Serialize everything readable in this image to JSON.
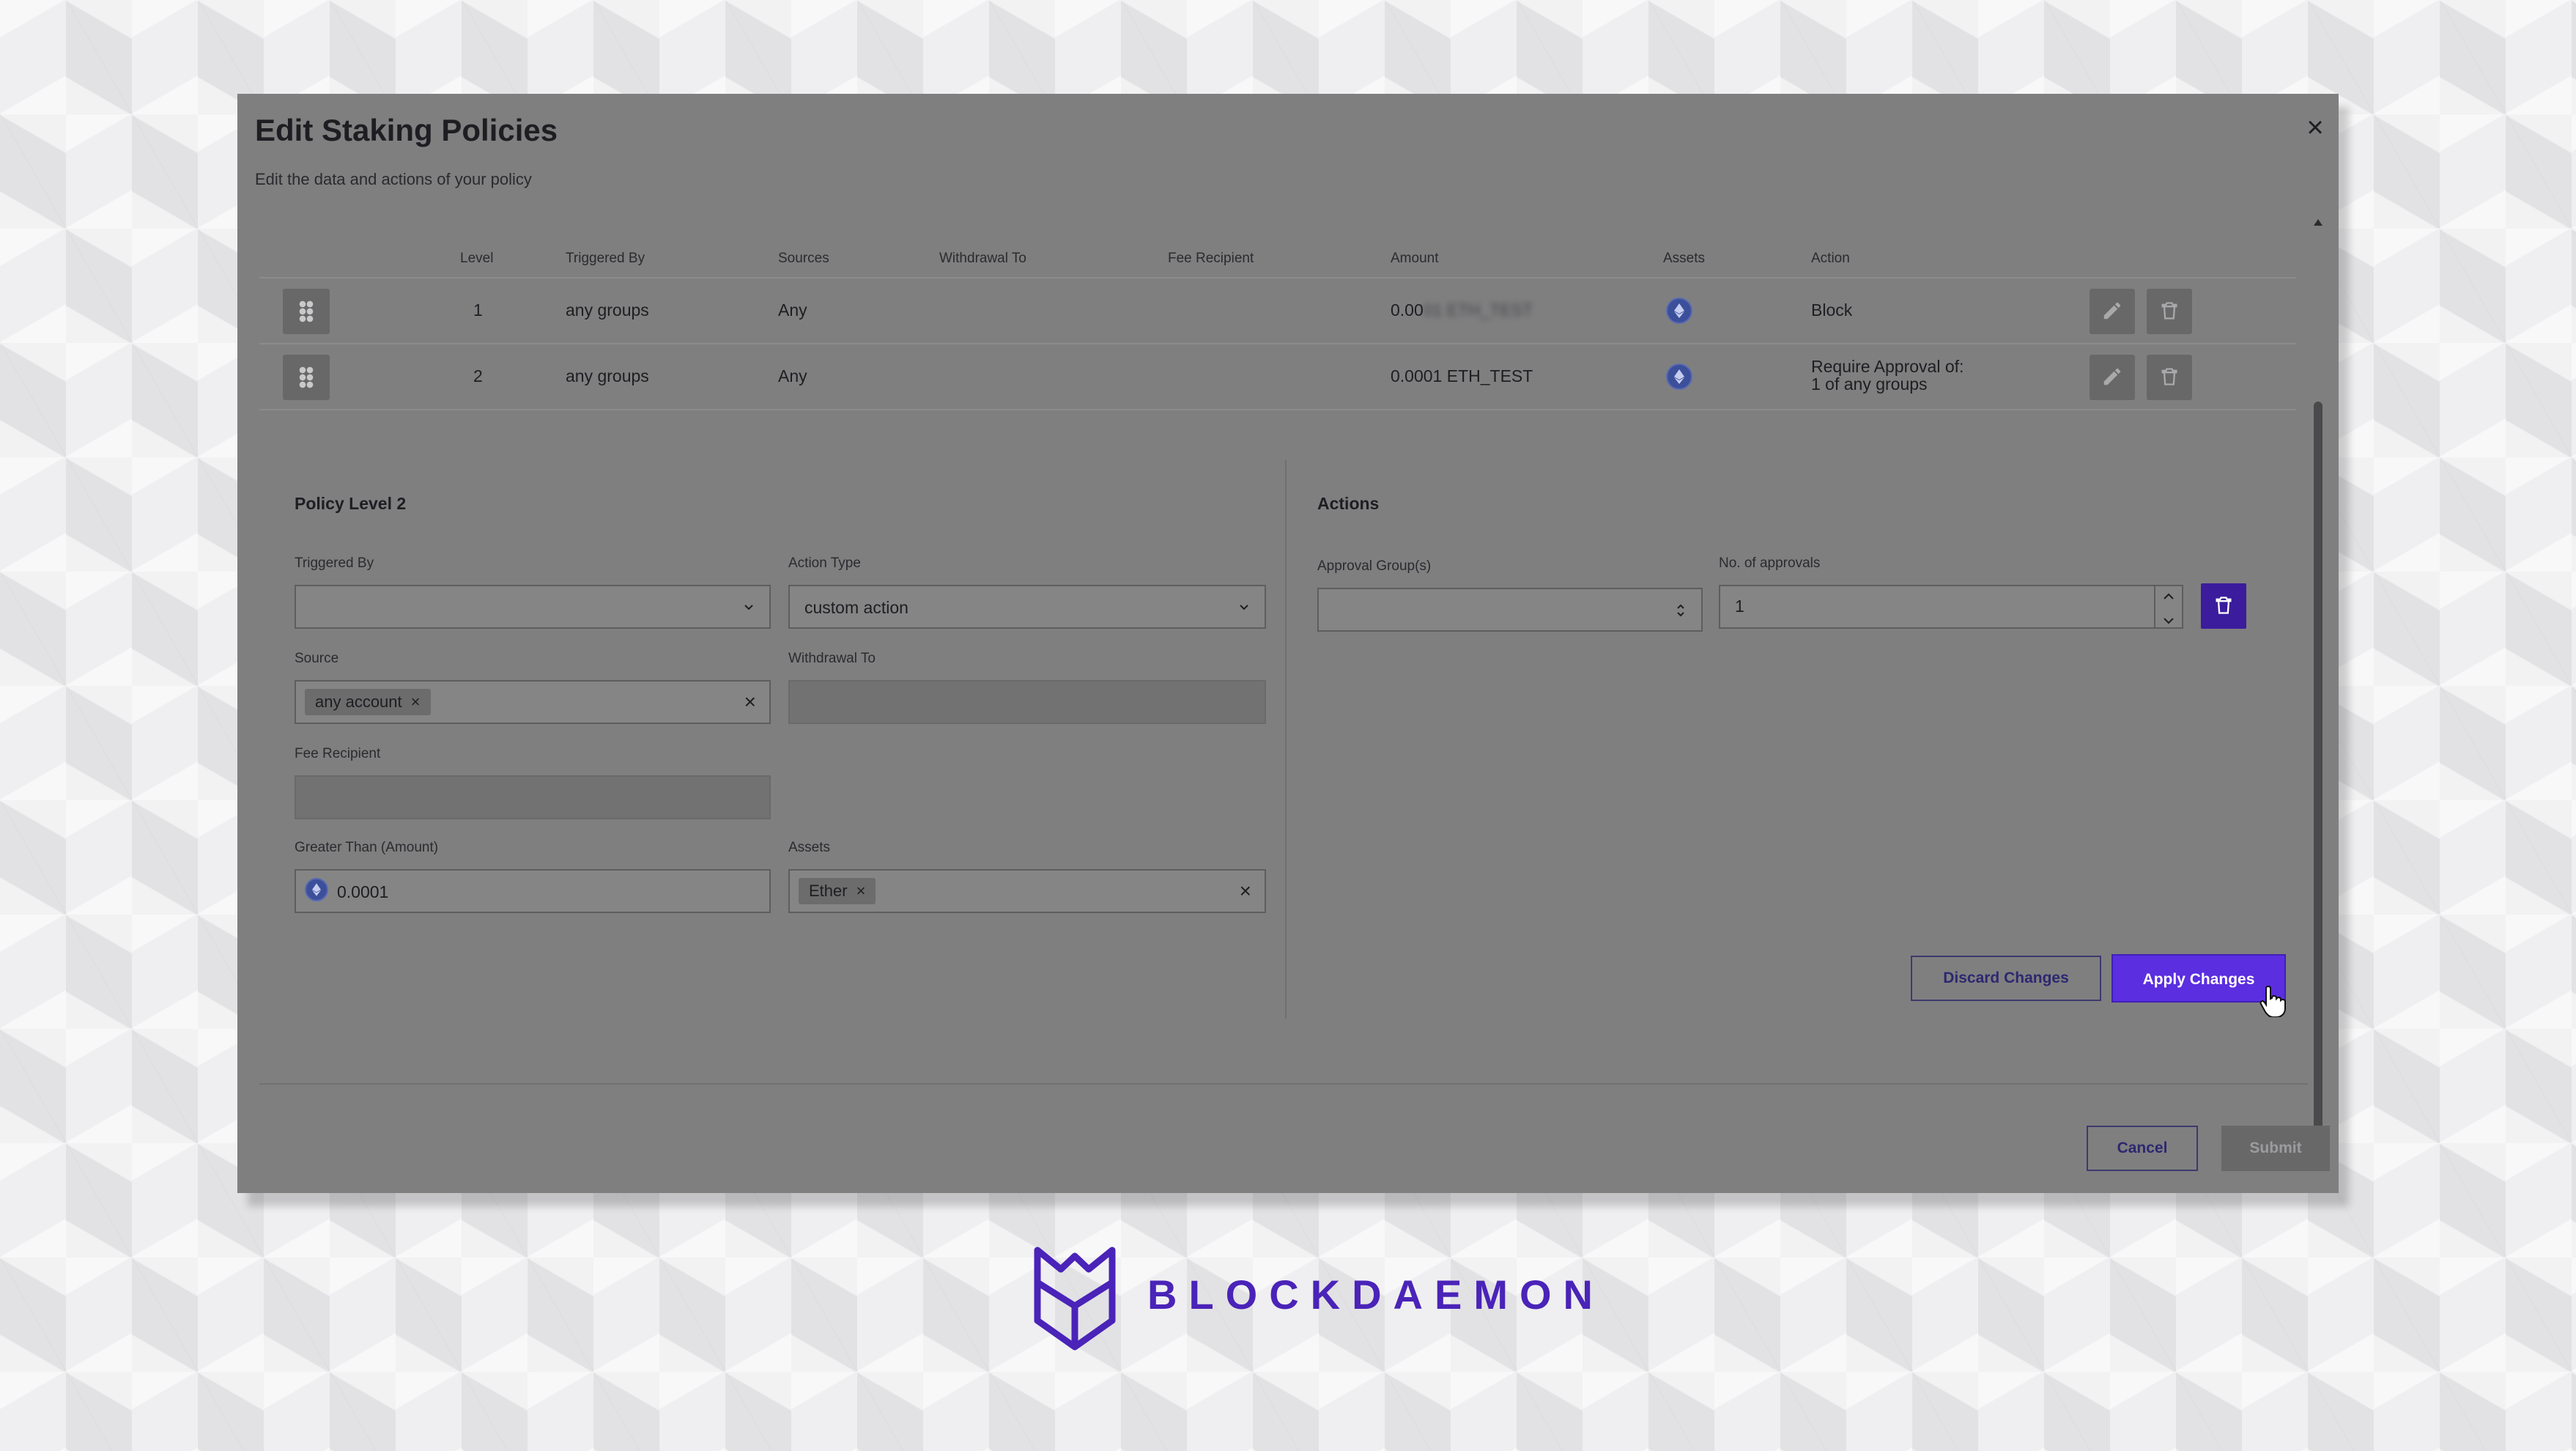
{
  "modal": {
    "title": "Edit Staking Policies",
    "subtitle": "Edit the data and actions of your policy"
  },
  "table": {
    "headers": [
      "Level",
      "Triggered By",
      "Sources",
      "Withdrawal To",
      "Fee Recipient",
      "Amount",
      "Assets",
      "Action"
    ],
    "rows": [
      {
        "level": "1",
        "triggered_by": "any groups",
        "sources": "Any",
        "amount": "0.00",
        "amount_blurred": "01 ETH_TEST",
        "action_line1": "Block",
        "action_line2": ""
      },
      {
        "level": "2",
        "triggered_by": "any groups",
        "sources": "Any",
        "amount": "0.0001 ETH_TEST",
        "amount_blurred": "",
        "action_line1": "Require Approval of:",
        "action_line2": "1 of any groups"
      }
    ]
  },
  "policy": {
    "title": "Policy Level 2",
    "triggered_by_label": "Triggered By",
    "triggered_by_value": "",
    "action_type_label": "Action Type",
    "action_type_value": "custom action",
    "source_label": "Source",
    "source_chip": "any account",
    "withdrawal_label": "Withdrawal To",
    "fee_label": "Fee Recipient",
    "amount_label": "Greater Than (Amount)",
    "amount_value": "0.0001",
    "assets_label": "Assets",
    "assets_chip": "Ether"
  },
  "actions": {
    "title": "Actions",
    "approval_groups_label": "Approval Group(s)",
    "approvals_label": "No. of approvals",
    "approvals_value": "1"
  },
  "buttons": {
    "discard": "Discard Changes",
    "apply": "Apply Changes",
    "cancel": "Cancel",
    "submit": "Submit"
  },
  "brand": {
    "name": "BLOCKDAEMON",
    "color": "#4a23b8"
  },
  "colors": {
    "primary": "#5b2ee0",
    "overlay": "#7f7f80"
  }
}
